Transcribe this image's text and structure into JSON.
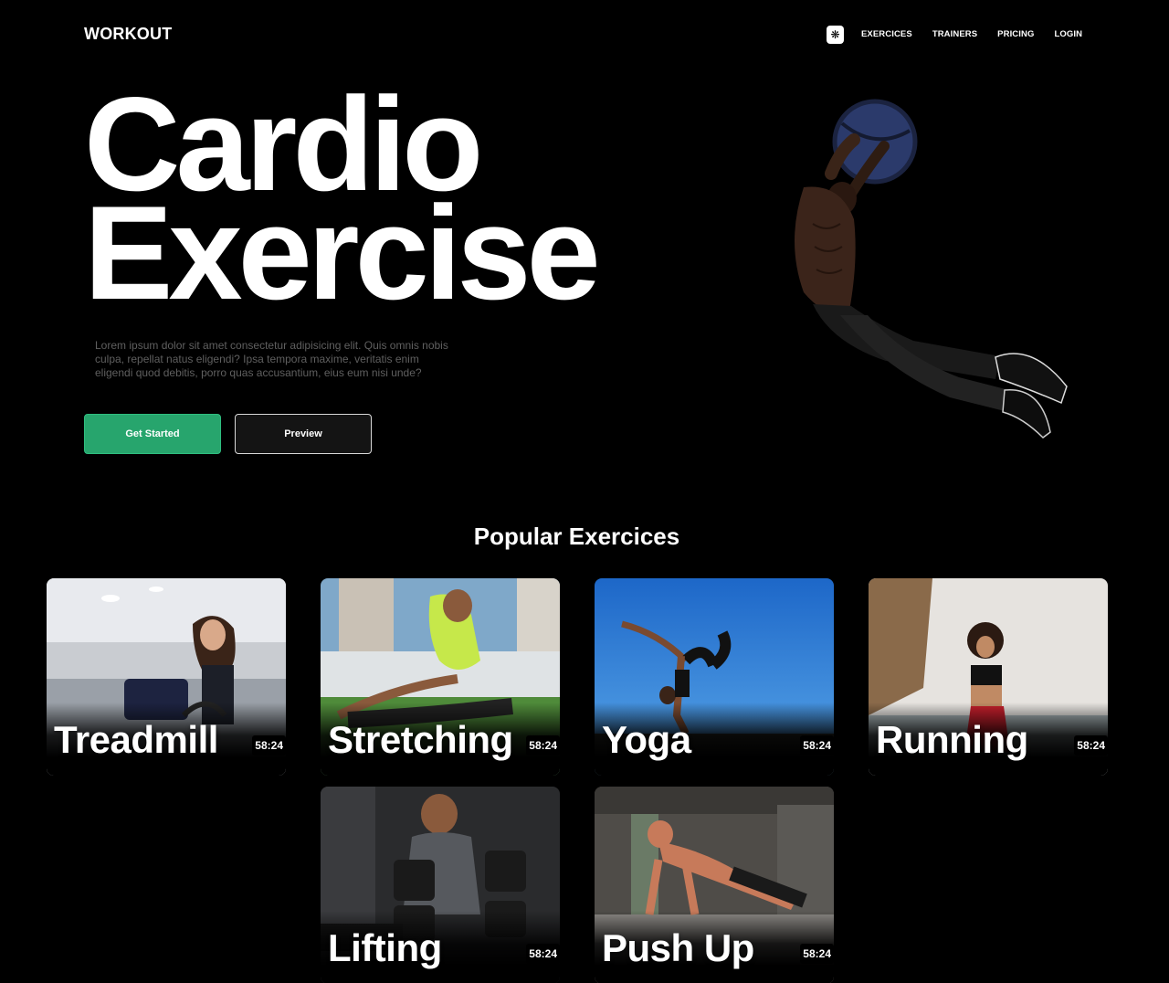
{
  "header": {
    "brand": "WORKOUT",
    "nav": [
      "EXERCICES",
      "TRAINERS",
      "PRICING",
      "LOGIN"
    ]
  },
  "hero": {
    "title_line1": "Cardio",
    "title_line2": "Exercise",
    "description": "Lorem ipsum dolor sit amet consectetur adipisicing elit. Quis omnis nobis culpa, repellat natus eligendi? Ipsa tempora maxime, veritatis enim eligendi quod debitis, porro quas accusantium, eius eum nisi unde?",
    "primary_button": "Get Started",
    "secondary_button": "Preview"
  },
  "section": {
    "title": "Popular Exercices"
  },
  "cards": [
    {
      "name": "Treadmill",
      "duration": "58:24"
    },
    {
      "name": "Stretching",
      "duration": "58:24"
    },
    {
      "name": "Yoga",
      "duration": "58:24"
    },
    {
      "name": "Running",
      "duration": "58:24"
    },
    {
      "name": "Lifting",
      "duration": "58:24"
    },
    {
      "name": "Push Up",
      "duration": "58:24"
    }
  ],
  "colors": {
    "background": "#000000",
    "accent_green": "#27a56d",
    "text_muted": "#5f5f5f"
  },
  "icons": {
    "menu_toggle": "gear-icon"
  }
}
